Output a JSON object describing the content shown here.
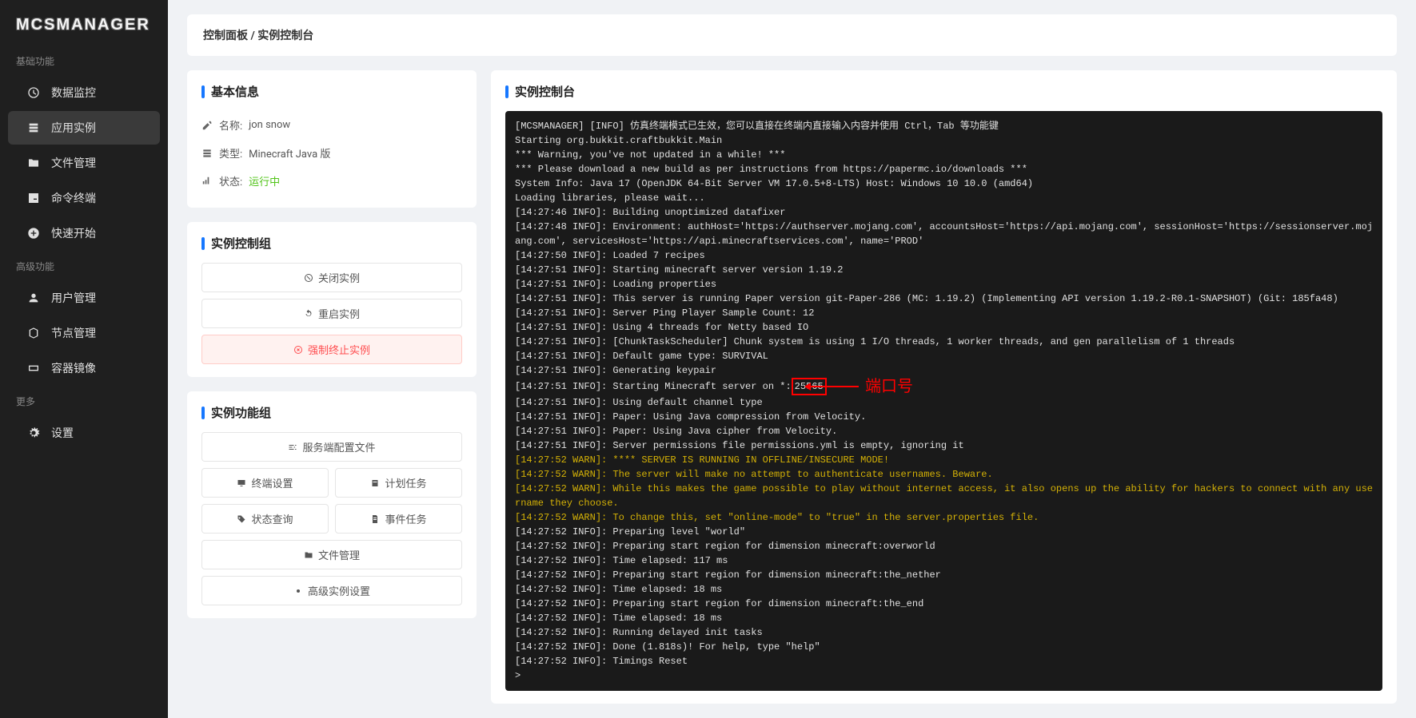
{
  "logo": "MCSMANAGER",
  "sidebar": {
    "section_basic": "基础功能",
    "section_advanced": "高级功能",
    "section_more": "更多",
    "items": [
      {
        "label": "数据监控"
      },
      {
        "label": "应用实例"
      },
      {
        "label": "文件管理"
      },
      {
        "label": "命令终端"
      },
      {
        "label": "快速开始"
      }
    ],
    "adv_items": [
      {
        "label": "用户管理"
      },
      {
        "label": "节点管理"
      },
      {
        "label": "容器镜像"
      }
    ],
    "more_items": [
      {
        "label": "设置"
      }
    ]
  },
  "breadcrumb": "控制面板 / 实例控制台",
  "basic_info": {
    "title": "基本信息",
    "name_label": "名称:",
    "name_value": "jon snow",
    "type_label": "类型:",
    "type_value": "Minecraft Java 版",
    "status_label": "状态:",
    "status_value": "运行中"
  },
  "control_group": {
    "title": "实例控制组",
    "close_btn": "关闭实例",
    "restart_btn": "重启实例",
    "kill_btn": "强制终止实例"
  },
  "func_group": {
    "title": "实例功能组",
    "server_config": "服务端配置文件",
    "terminal_settings": "终端设置",
    "scheduled_tasks": "计划任务",
    "status_query": "状态查询",
    "event_tasks": "事件任务",
    "file_manage": "文件管理",
    "advanced_settings": "高级实例设置"
  },
  "console": {
    "title": "实例控制台",
    "annotation_label": "端口号",
    "port_value": "25565",
    "lines": [
      {
        "cls": "",
        "text": "[MCSMANAGER] [INFO] 仿真终端模式已生效，您可以直接在终端内直接输入内容并使用 Ctrl，Tab 等功能键"
      },
      {
        "cls": "",
        "text": "Starting org.bukkit.craftbukkit.Main"
      },
      {
        "cls": "",
        "text": "*** Warning, you've not updated in a while! ***"
      },
      {
        "cls": "",
        "text": "*** Please download a new build as per instructions from https://papermc.io/downloads ***"
      },
      {
        "cls": "",
        "text": "System Info: Java 17 (OpenJDK 64-Bit Server VM 17.0.5+8-LTS) Host: Windows 10 10.0 (amd64)"
      },
      {
        "cls": "",
        "text": "Loading libraries, please wait..."
      },
      {
        "cls": "",
        "text": "[14:27:46 INFO]: Building unoptimized datafixer"
      },
      {
        "cls": "",
        "text": "[14:27:48 INFO]: Environment: authHost='https://authserver.mojang.com', accountsHost='https://api.mojang.com', sessionHost='https://sessionserver.mojang.com', servicesHost='https://api.minecraftservices.com', name='PROD'"
      },
      {
        "cls": "",
        "text": "[14:27:50 INFO]: Loaded 7 recipes"
      },
      {
        "cls": "",
        "text": "[14:27:51 INFO]: Starting minecraft server version 1.19.2"
      },
      {
        "cls": "",
        "text": "[14:27:51 INFO]: Loading properties"
      },
      {
        "cls": "",
        "text": "[14:27:51 INFO]: This server is running Paper version git-Paper-286 (MC: 1.19.2) (Implementing API version 1.19.2-R0.1-SNAPSHOT) (Git: 185fa48)"
      },
      {
        "cls": "",
        "text": "[14:27:51 INFO]: Server Ping Player Sample Count: 12"
      },
      {
        "cls": "",
        "text": "[14:27:51 INFO]: Using 4 threads for Netty based IO"
      },
      {
        "cls": "",
        "text": "[14:27:51 INFO]: [ChunkTaskScheduler] Chunk system is using 1 I/O threads, 1 worker threads, and gen parallelism of 1 threads"
      },
      {
        "cls": "",
        "text": "[14:27:51 INFO]: Default game type: SURVIVAL"
      },
      {
        "cls": "",
        "text": "[14:27:51 INFO]: Generating keypair"
      },
      {
        "cls": "port",
        "prefix": "[14:27:51 INFO]: Starting Minecraft server on *:"
      },
      {
        "cls": "",
        "text": "[14:27:51 INFO]: Using default channel type"
      },
      {
        "cls": "",
        "text": "[14:27:51 INFO]: Paper: Using Java compression from Velocity."
      },
      {
        "cls": "",
        "text": "[14:27:51 INFO]: Paper: Using Java cipher from Velocity."
      },
      {
        "cls": "",
        "text": "[14:27:51 INFO]: Server permissions file permissions.yml is empty, ignoring it"
      },
      {
        "cls": "term-warn",
        "text": "[14:27:52 WARN]: **** SERVER IS RUNNING IN OFFLINE/INSECURE MODE!"
      },
      {
        "cls": "term-warn",
        "text": "[14:27:52 WARN]: The server will make no attempt to authenticate usernames. Beware."
      },
      {
        "cls": "term-warn",
        "text": "[14:27:52 WARN]: While this makes the game possible to play without internet access, it also opens up the ability for hackers to connect with any username they choose."
      },
      {
        "cls": "term-warn",
        "text": "[14:27:52 WARN]: To change this, set \"online-mode\" to \"true\" in the server.properties file."
      },
      {
        "cls": "",
        "text": "[14:27:52 INFO]: Preparing level \"world\""
      },
      {
        "cls": "",
        "text": "[14:27:52 INFO]: Preparing start region for dimension minecraft:overworld"
      },
      {
        "cls": "",
        "text": "[14:27:52 INFO]: Time elapsed: 117 ms"
      },
      {
        "cls": "",
        "text": "[14:27:52 INFO]: Preparing start region for dimension minecraft:the_nether"
      },
      {
        "cls": "",
        "text": "[14:27:52 INFO]: Time elapsed: 18 ms"
      },
      {
        "cls": "",
        "text": "[14:27:52 INFO]: Preparing start region for dimension minecraft:the_end"
      },
      {
        "cls": "",
        "text": "[14:27:52 INFO]: Time elapsed: 18 ms"
      },
      {
        "cls": "",
        "text": "[14:27:52 INFO]: Running delayed init tasks"
      },
      {
        "cls": "",
        "text": "[14:27:52 INFO]: Done (1.818s)! For help, type \"help\""
      },
      {
        "cls": "",
        "text": "[14:27:52 INFO]: Timings Reset"
      },
      {
        "cls": "",
        "text": ">"
      }
    ]
  }
}
